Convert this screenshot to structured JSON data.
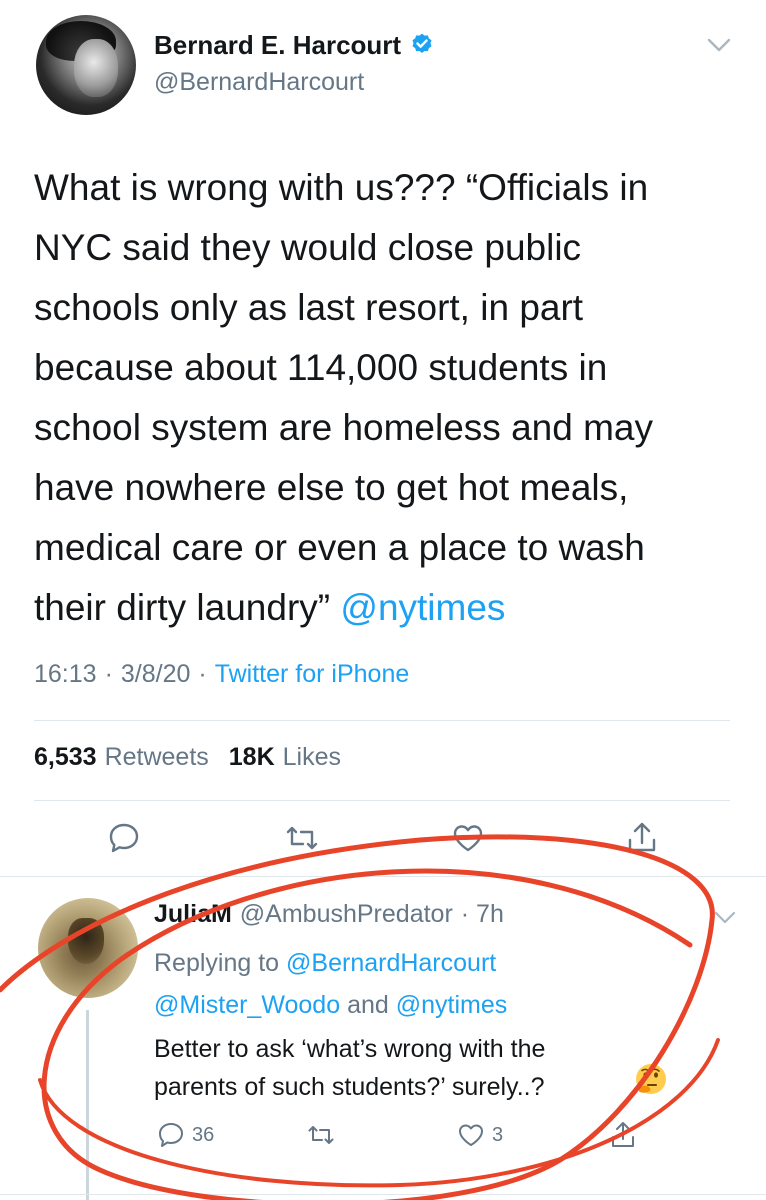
{
  "tweet": {
    "author_name": "Bernard E. Harcourt",
    "author_handle": "@BernardHarcourt",
    "text": "What is wrong with us??? “Officials in\nNYC said they would close public\nschools only as last resort, in part\nbecause about 114,000 students in\nschool system are homeless and may\nhave nowhere else to get hot meals,\nmedical care or even a place to wash\ntheir dirty laundry” ",
    "mention": "@nytimes",
    "time": "16:13",
    "date": "3/8/20",
    "separator": "·",
    "source": "Twitter for iPhone",
    "retweets_count": "6,533",
    "retweets_label": "Retweets",
    "likes_count": "18K",
    "likes_label": "Likes"
  },
  "reply": {
    "author_name": "JuliaM",
    "author_handle": "@AmbushPredator",
    "time": "· 7h",
    "replying_prefix": "Replying to",
    "replying_to_1": "@BernardHarcourt",
    "replying_to_2": "@Mister_Woodo",
    "replying_and": "and",
    "replying_to_3": "@nytimes",
    "text": "Better to ask ‘what’s wrong with the\nparents of such students?’ surely..?",
    "reply_count": "36",
    "like_count": "3"
  },
  "colors": {
    "accent": "#1da1f2",
    "secondary_text": "#657786",
    "annotation": "#e8442a"
  },
  "icons": [
    "verified-badge-icon",
    "chevron-down-icon",
    "reply-icon",
    "retweet-icon",
    "like-icon",
    "share-icon",
    "thinking-face-icon"
  ]
}
